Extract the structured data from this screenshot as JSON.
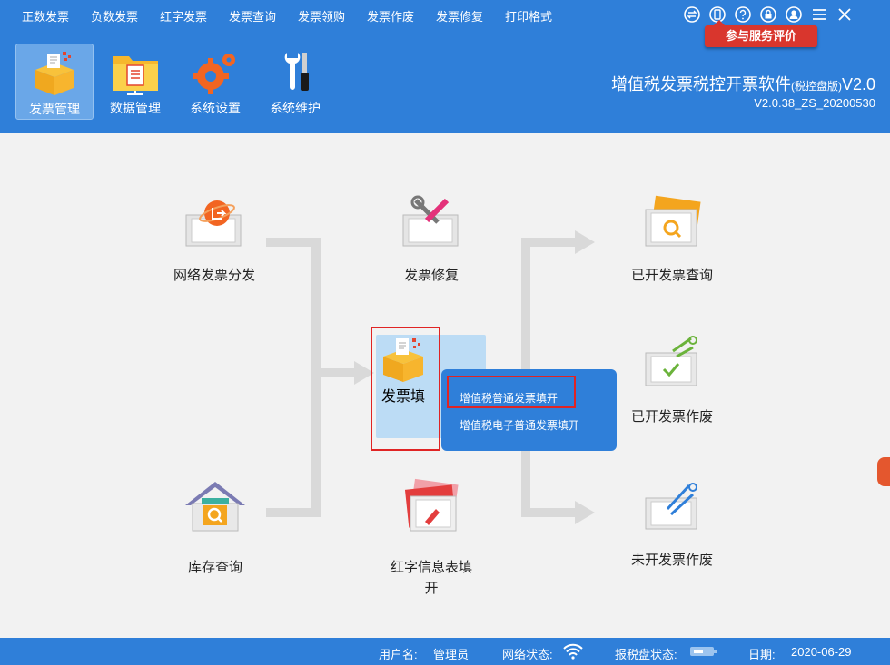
{
  "menubar": {
    "items": [
      "正数发票",
      "负数发票",
      "红字发票",
      "发票查询",
      "发票领购",
      "发票作废",
      "发票修复",
      "打印格式"
    ]
  },
  "window_icons": [
    "switch-icon",
    "mobile-icon",
    "help-icon",
    "lock-icon",
    "user-icon",
    "menu-icon",
    "close-icon"
  ],
  "eval_button": "参与服务评价",
  "toolbar": {
    "items": [
      {
        "label": "发票管理",
        "icon": "invoice-box-icon",
        "active": true
      },
      {
        "label": "数据管理",
        "icon": "folder-icon",
        "active": false
      },
      {
        "label": "系统设置",
        "icon": "gear-icon",
        "active": false
      },
      {
        "label": "系统维护",
        "icon": "tools-icon",
        "active": false
      }
    ]
  },
  "app": {
    "title_main": "增值税发票税控开票软件",
    "title_small": "(税控盘版)",
    "title_ver": "V2.0",
    "version": "V2.0.38_ZS_20200530"
  },
  "flow": {
    "network_dist": "网络发票分发",
    "repair": "发票修复",
    "fill": "发票填开",
    "fill_visible": "发票填",
    "inventory": "库存查询",
    "red_info": "红字信息表填开",
    "red_info_line1": "红字信息表填",
    "red_info_line2": "开",
    "issued_query": "已开发票查询",
    "issued_void": "已开发票作废",
    "unissued_void": "未开发票作废"
  },
  "popup": {
    "items": [
      "增值税普通发票填开",
      "增值税电子普通发票填开"
    ]
  },
  "status": {
    "user_label": "用户名:",
    "user": "管理员",
    "network_label": "网络状态:",
    "disk_label": "报税盘状态:",
    "date_label": "日期:",
    "date": "2020-06-29"
  },
  "colors": {
    "primary": "#2f7fd9",
    "highlight": "#bcdcf5",
    "accent_red": "#d9362d",
    "callout_red": "#e02424",
    "flow_gray": "#d9d9d9"
  }
}
